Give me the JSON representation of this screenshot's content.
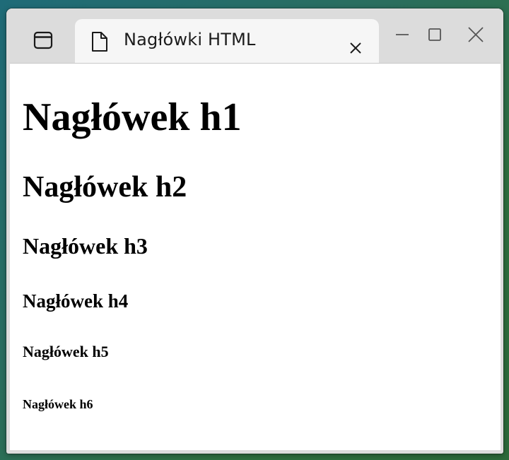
{
  "window": {
    "tab_title": "Nagłówki HTML"
  },
  "icons": {
    "window_menu": "window-icon",
    "tab_file": "file-icon",
    "tab_close": "close-icon",
    "minimize": "minimize-icon",
    "maximize": "maximize-icon",
    "close": "close-icon"
  },
  "content": {
    "headings": [
      "Nagłówek h1",
      "Nagłówek h2",
      "Nagłówek h3",
      "Nagłówek h4",
      "Nagłówek h5",
      "Nagłówek h6"
    ]
  },
  "colors": {
    "titlebar": "#dcdcdc",
    "tab": "#f6f6f6",
    "page_background": "#ffffff",
    "text": "#000000"
  }
}
